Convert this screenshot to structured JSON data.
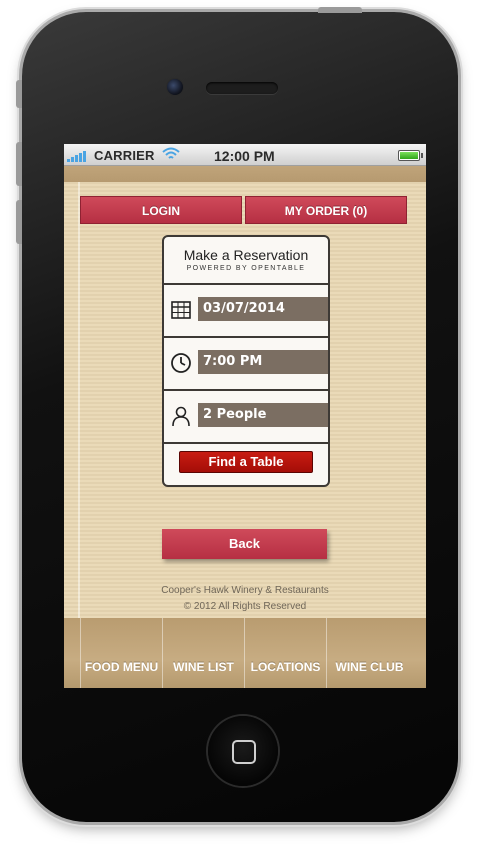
{
  "status_bar": {
    "carrier": "CARRIER",
    "time": "12:00 PM",
    "signal_icon": "signal-bars-icon",
    "wifi_icon": "wifi-icon",
    "battery_icon": "battery-icon",
    "battery_level": 1.0
  },
  "header": {
    "login_label": "LOGIN",
    "my_order_label": "MY ORDER (0)"
  },
  "reservation": {
    "title": "Make a Reservation",
    "powered_by": "POWERED BY OPENTABLE",
    "date": {
      "icon": "calendar-icon",
      "value": "03/07/2014"
    },
    "time": {
      "icon": "clock-icon",
      "value": "7:00 PM"
    },
    "party": {
      "icon": "person-icon",
      "value": "2 People"
    },
    "find_table_label": "Find a Table"
  },
  "back_label": "Back",
  "footer": {
    "company": "Cooper's Hawk Winery & Restaurants",
    "copyright": "© 2012 All Rights Reserved"
  },
  "bottom_nav": {
    "items": [
      {
        "label": "FOOD MENU"
      },
      {
        "label": "WINE LIST"
      },
      {
        "label": "LOCATIONS"
      },
      {
        "label": "WINE CLUB"
      }
    ]
  },
  "colors": {
    "accent_red": "#c23a4c",
    "find_button_red": "#b8140c",
    "field_brown": "#7b6e62",
    "background_tan": "#e9d8b4",
    "nav_tan": "#c0a47a"
  }
}
